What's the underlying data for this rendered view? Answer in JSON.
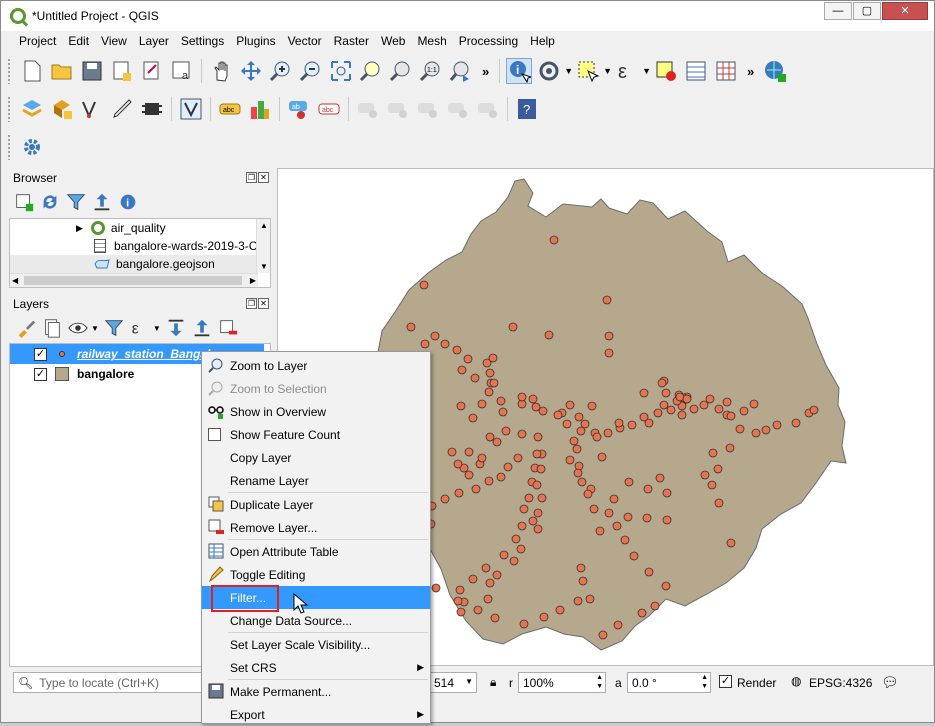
{
  "window": {
    "title": "*Untitled Project - QGIS"
  },
  "menubar": [
    "Project",
    "Edit",
    "View",
    "Layer",
    "Settings",
    "Plugins",
    "Vector",
    "Raster",
    "Web",
    "Mesh",
    "Processing",
    "Help"
  ],
  "browser": {
    "title": "Browser",
    "items": [
      {
        "label": "air_quality"
      },
      {
        "label": "bangalore-wards-2019-3-C"
      },
      {
        "label": "bangalore.geojson"
      }
    ]
  },
  "layers": {
    "title": "Layers",
    "items": [
      {
        "label": "railway_station_Bangalo",
        "checked": true
      },
      {
        "label": "bangalore",
        "checked": true
      }
    ]
  },
  "context_menu": {
    "items": [
      "Zoom to Layer",
      "Zoom to Selection",
      "Show in Overview",
      "Show Feature Count",
      "Copy Layer",
      "Rename Layer",
      "Duplicate Layer",
      "Remove Layer...",
      "Open Attribute Table",
      "Toggle Editing",
      "Filter...",
      "Change Data Source...",
      "Set Layer Scale Visibility...",
      "Set CRS",
      "Make Permanent...",
      "Export"
    ],
    "disabled": [
      "Zoom to Selection"
    ],
    "selected": "Filter...",
    "submenus": [
      "Set CRS",
      "Export"
    ]
  },
  "status": {
    "locator_placeholder": "Type to locate (Ctrl+K)",
    "scale_partial": "514",
    "rotation_label": "a",
    "magnifier_label": "r",
    "magnifier": "100%",
    "rotation": "0.0 °",
    "render_label": "Render",
    "crs": "EPSG:4326"
  },
  "colors": {
    "accent": "#3399ff",
    "polygon_fill": "#b5a88d",
    "point_fill": "#e8734f",
    "highlight": "#e02020"
  }
}
